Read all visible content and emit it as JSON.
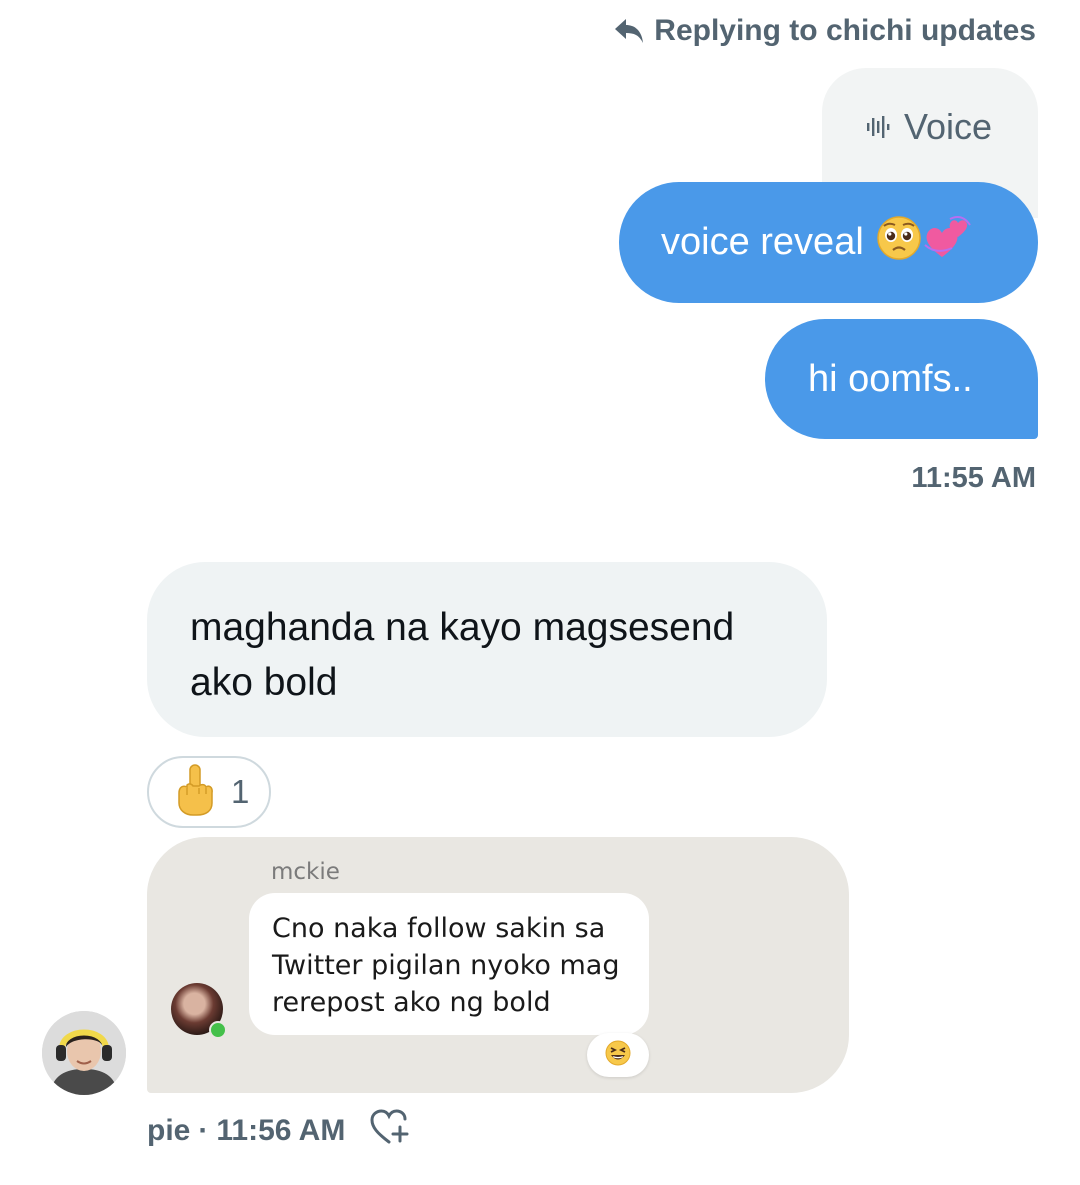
{
  "reply_header": {
    "text": "Replying to chichi updates"
  },
  "voice_preview": {
    "label": "Voice"
  },
  "outgoing": {
    "messages": [
      {
        "text": "voice reveal",
        "emojis": [
          "pleading-face",
          "two-hearts"
        ]
      },
      {
        "text": "hi oomfs.."
      }
    ],
    "time": "11:55 AM"
  },
  "incoming": {
    "message": "maghanda na kayo magsesend ako bold",
    "reaction": {
      "emoji": "middle-finger",
      "count": "1"
    },
    "screenshot": {
      "sender": "mckie",
      "message": "Cno naka follow sakin sa Twitter pigilan nyoko mag rerepost ako ng bold",
      "reaction_emoji": "grinning-squinting-face"
    },
    "sender_name": "pie",
    "separator": "·",
    "time": "11:56 AM"
  },
  "colors": {
    "outgoing_bubble": "#4a99e9",
    "incoming_bubble": "#eff3f4",
    "secondary_text": "#536471"
  }
}
